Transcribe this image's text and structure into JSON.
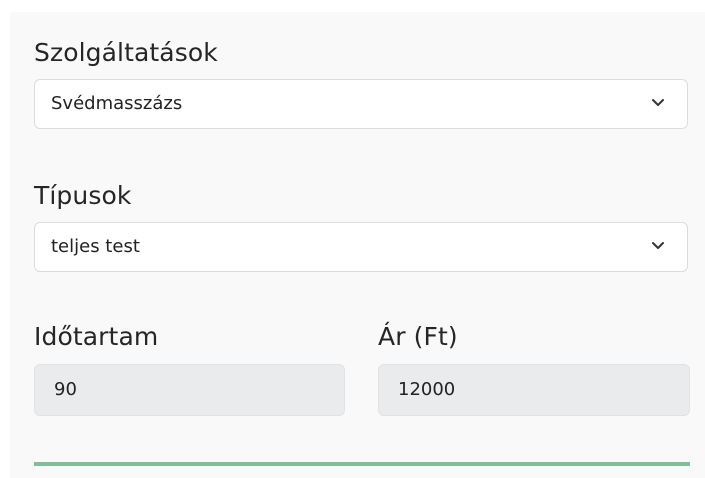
{
  "services": {
    "label": "Szolgáltatások",
    "selected": "Svédmasszázs"
  },
  "types": {
    "label": "Típusok",
    "selected": "teljes test"
  },
  "duration": {
    "label": "Időtartam",
    "value": "90"
  },
  "price": {
    "label": "Ár (Ft)",
    "value": "12000"
  },
  "icons": {
    "dropdown": "chevron-down-icon"
  },
  "colors": {
    "divider": "#7fbf9a"
  }
}
